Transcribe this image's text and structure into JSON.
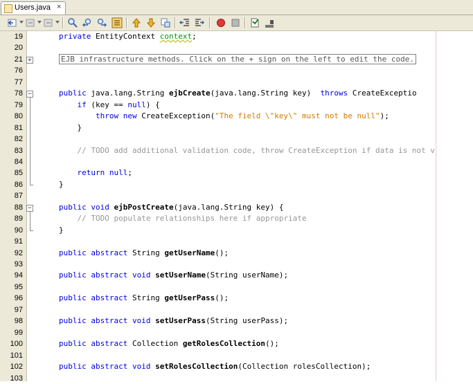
{
  "tab": {
    "label": "Users.java",
    "close": "×"
  },
  "toolbar": {
    "icons": [
      "back-icon",
      "history-icon",
      "forward-icon",
      "find-icon",
      "find-previous-icon",
      "find-next-icon",
      "toggle-highlight-icon",
      "previous-bookmark-icon",
      "next-bookmark-icon",
      "toggle-bookmark-icon",
      "shift-left-icon",
      "shift-right-icon",
      "start-macro-icon",
      "stop-macro-icon",
      "comment-icon",
      "uncomment-icon"
    ]
  },
  "editor": {
    "lines": [
      {
        "n": "19",
        "parts": [
          [
            "kw",
            "private"
          ],
          [
            "",
            ""
          ],
          [
            "",
            " EntityContext "
          ],
          [
            "fld",
            "context"
          ],
          [
            "",
            ";"
          ]
        ]
      },
      {
        "n": "20",
        "parts": []
      },
      {
        "n": "21",
        "parts": [
          [
            "fd",
            "EJB infrastructure methods. Click on the + sign on the left to edit the code."
          ]
        ]
      },
      {
        "n": "76",
        "parts": []
      },
      {
        "n": "77",
        "parts": []
      },
      {
        "n": "78",
        "parts": [
          [
            "kw",
            "public"
          ],
          [
            "",
            " java.lang.String "
          ],
          [
            "b",
            "ejbCreate"
          ],
          [
            "",
            "(java.lang.String key)  "
          ],
          [
            "kw",
            "throws"
          ],
          [
            "",
            " CreateExceptio"
          ]
        ]
      },
      {
        "n": "79",
        "parts": [
          [
            "",
            "    "
          ],
          [
            "kw",
            "if"
          ],
          [
            "",
            " (key == "
          ],
          [
            "kw",
            "null"
          ],
          [
            "",
            ") {"
          ]
        ]
      },
      {
        "n": "80",
        "parts": [
          [
            "",
            "        "
          ],
          [
            "kw",
            "throw"
          ],
          [
            "",
            " "
          ],
          [
            "kw",
            "new"
          ],
          [
            "",
            " CreateException("
          ],
          [
            "str",
            "\"The field \\\"key\\\" must not be null\""
          ],
          [
            "",
            ");"
          ]
        ]
      },
      {
        "n": "81",
        "parts": [
          [
            "",
            "    }"
          ]
        ]
      },
      {
        "n": "82",
        "parts": []
      },
      {
        "n": "83",
        "parts": [
          [
            "cm",
            "    // TODO add additional validation code, throw CreateException if data is not v"
          ]
        ]
      },
      {
        "n": "84",
        "parts": []
      },
      {
        "n": "85",
        "parts": [
          [
            "",
            "    "
          ],
          [
            "kw",
            "return"
          ],
          [
            "",
            " "
          ],
          [
            "kw",
            "null"
          ],
          [
            "",
            ";"
          ]
        ]
      },
      {
        "n": "86",
        "parts": [
          [
            "",
            "}"
          ]
        ]
      },
      {
        "n": "87",
        "parts": []
      },
      {
        "n": "88",
        "parts": [
          [
            "kw",
            "public"
          ],
          [
            "",
            " "
          ],
          [
            "kw",
            "void"
          ],
          [
            "",
            " "
          ],
          [
            "b",
            "ejbPostCreate"
          ],
          [
            "",
            "(java.lang.String key) {"
          ]
        ]
      },
      {
        "n": "89",
        "parts": [
          [
            "cm",
            "    // TODO populate relationships here if appropriate"
          ]
        ]
      },
      {
        "n": "90",
        "parts": [
          [
            "",
            "}"
          ]
        ]
      },
      {
        "n": "91",
        "parts": []
      },
      {
        "n": "92",
        "parts": [
          [
            "kw",
            "public"
          ],
          [
            "",
            " "
          ],
          [
            "kw",
            "abstract"
          ],
          [
            "",
            " String "
          ],
          [
            "b",
            "getUserName"
          ],
          [
            "",
            "();"
          ]
        ]
      },
      {
        "n": "93",
        "parts": []
      },
      {
        "n": "94",
        "parts": [
          [
            "kw",
            "public"
          ],
          [
            "",
            " "
          ],
          [
            "kw",
            "abstract"
          ],
          [
            "",
            " "
          ],
          [
            "kw",
            "void"
          ],
          [
            "",
            " "
          ],
          [
            "b",
            "setUserName"
          ],
          [
            "",
            "(String userName);"
          ]
        ]
      },
      {
        "n": "95",
        "parts": []
      },
      {
        "n": "96",
        "parts": [
          [
            "kw",
            "public"
          ],
          [
            "",
            " "
          ],
          [
            "kw",
            "abstract"
          ],
          [
            "",
            " String "
          ],
          [
            "b",
            "getUserPass"
          ],
          [
            "",
            "();"
          ]
        ]
      },
      {
        "n": "97",
        "parts": []
      },
      {
        "n": "98",
        "parts": [
          [
            "kw",
            "public"
          ],
          [
            "",
            " "
          ],
          [
            "kw",
            "abstract"
          ],
          [
            "",
            " "
          ],
          [
            "kw",
            "void"
          ],
          [
            "",
            " "
          ],
          [
            "b",
            "setUserPass"
          ],
          [
            "",
            "(String userPass);"
          ]
        ]
      },
      {
        "n": "99",
        "parts": []
      },
      {
        "n": "100",
        "parts": [
          [
            "kw",
            "public"
          ],
          [
            "",
            " "
          ],
          [
            "kw",
            "abstract"
          ],
          [
            "",
            " Collection "
          ],
          [
            "b",
            "getRolesCollection"
          ],
          [
            "",
            "();"
          ]
        ]
      },
      {
        "n": "101",
        "parts": []
      },
      {
        "n": "102",
        "parts": [
          [
            "kw",
            "public"
          ],
          [
            "",
            " "
          ],
          [
            "kw",
            "abstract"
          ],
          [
            "",
            " "
          ],
          [
            "kw",
            "void"
          ],
          [
            "",
            " "
          ],
          [
            "b",
            "setRolesCollection"
          ],
          [
            "",
            "(Collection rolesCollection);"
          ]
        ]
      },
      {
        "n": "103",
        "parts": []
      }
    ]
  },
  "colors": {
    "keyword": "#0000e6",
    "string": "#ce7b00",
    "comment": "#969696",
    "field": "#009900",
    "chrome": "#ece9d8"
  }
}
